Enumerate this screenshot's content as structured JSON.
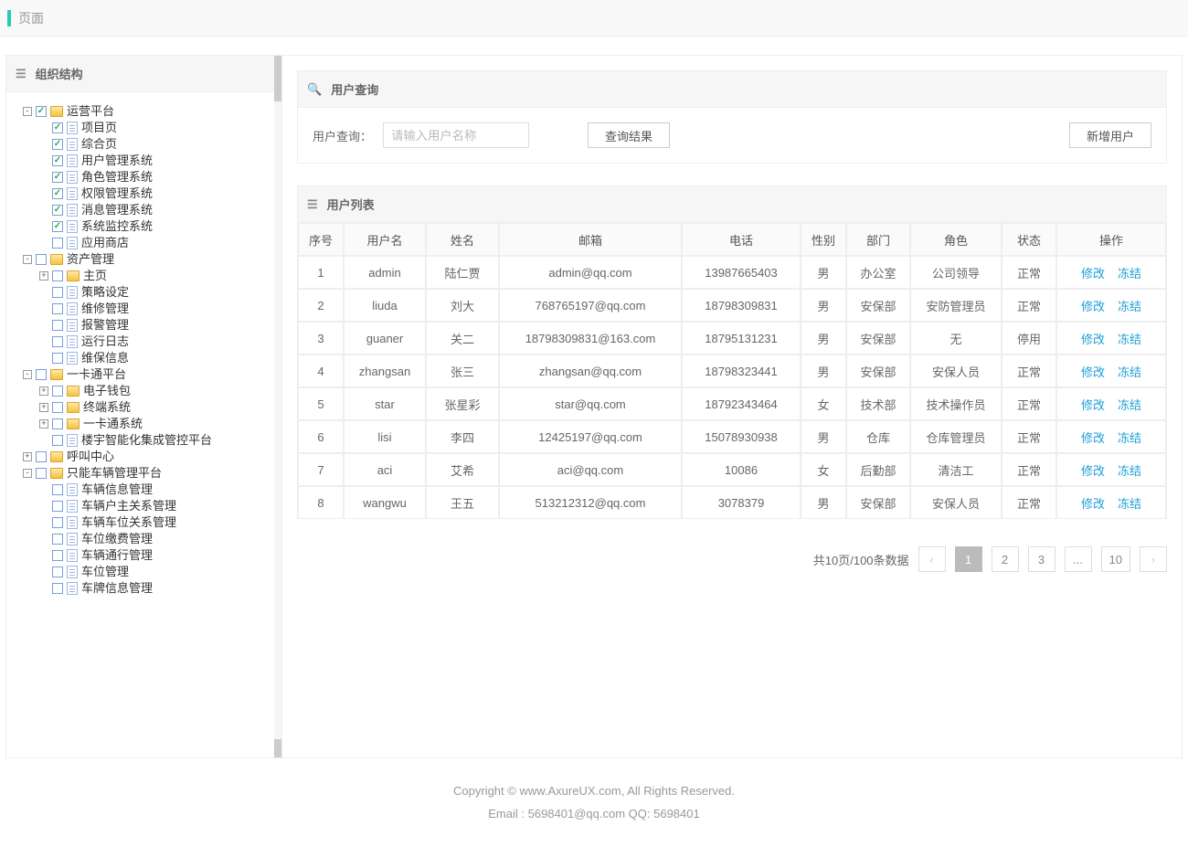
{
  "topbar": {
    "title": "页面"
  },
  "sidebar": {
    "title": "组织结构",
    "tree": [
      {
        "expand": "-",
        "checked": true,
        "icon": "folder",
        "label": "运营平台",
        "children": [
          {
            "expand": "",
            "checked": true,
            "icon": "page",
            "label": "项目页"
          },
          {
            "expand": "",
            "checked": true,
            "icon": "page",
            "label": "综合页"
          },
          {
            "expand": "",
            "checked": true,
            "icon": "page",
            "label": "用户管理系统"
          },
          {
            "expand": "",
            "checked": true,
            "icon": "page",
            "label": "角色管理系统"
          },
          {
            "expand": "",
            "checked": true,
            "icon": "page",
            "label": "权限管理系统"
          },
          {
            "expand": "",
            "checked": true,
            "icon": "page",
            "label": "消息管理系统"
          },
          {
            "expand": "",
            "checked": true,
            "icon": "page",
            "label": "系统监控系统"
          },
          {
            "expand": "",
            "checked": false,
            "icon": "page",
            "label": "应用商店"
          }
        ]
      },
      {
        "expand": "-",
        "checked": false,
        "icon": "folder",
        "label": "资产管理",
        "children": [
          {
            "expand": "+",
            "checked": false,
            "icon": "folder",
            "label": "主页"
          },
          {
            "expand": "",
            "checked": false,
            "icon": "page",
            "label": "策略设定"
          },
          {
            "expand": "",
            "checked": false,
            "icon": "page",
            "label": "维修管理"
          },
          {
            "expand": "",
            "checked": false,
            "icon": "page",
            "label": "报警管理"
          },
          {
            "expand": "",
            "checked": false,
            "icon": "page",
            "label": "运行日志"
          },
          {
            "expand": "",
            "checked": false,
            "icon": "page",
            "label": "维保信息"
          }
        ]
      },
      {
        "expand": "-",
        "checked": false,
        "icon": "folder",
        "label": "一卡通平台",
        "children": [
          {
            "expand": "+",
            "checked": false,
            "icon": "folder",
            "label": "电子钱包"
          },
          {
            "expand": "+",
            "checked": false,
            "icon": "folder",
            "label": "终端系统"
          },
          {
            "expand": "+",
            "checked": false,
            "icon": "folder",
            "label": "一卡通系统"
          },
          {
            "expand": "",
            "checked": false,
            "icon": "page",
            "label": "楼宇智能化集成管控平台"
          }
        ]
      },
      {
        "expand": "+",
        "checked": false,
        "icon": "folder",
        "label": "呼叫中心"
      },
      {
        "expand": "-",
        "checked": false,
        "icon": "folder",
        "label": "只能车辆管理平台",
        "children": [
          {
            "expand": "",
            "checked": false,
            "icon": "page",
            "label": "车辆信息管理"
          },
          {
            "expand": "",
            "checked": false,
            "icon": "page",
            "label": "车辆户主关系管理"
          },
          {
            "expand": "",
            "checked": false,
            "icon": "page",
            "label": "车辆车位关系管理"
          },
          {
            "expand": "",
            "checked": false,
            "icon": "page",
            "label": "车位缴费管理"
          },
          {
            "expand": "",
            "checked": false,
            "icon": "page",
            "label": "车辆通行管理"
          },
          {
            "expand": "",
            "checked": false,
            "icon": "page",
            "label": "车位管理"
          },
          {
            "expand": "",
            "checked": false,
            "icon": "page",
            "label": "车牌信息管理"
          }
        ]
      }
    ]
  },
  "search": {
    "panel_title": "用户查询",
    "label": "用户查询：",
    "placeholder": "请输入用户名称",
    "query_btn": "查询结果",
    "add_btn": "新增用户"
  },
  "table": {
    "panel_title": "用户列表",
    "headers": [
      "序号",
      "用户名",
      "姓名",
      "邮箱",
      "电话",
      "性别",
      "部门",
      "角色",
      "状态",
      "操作"
    ],
    "ops": {
      "edit": "修改",
      "freeze": "冻结"
    },
    "rows": [
      {
        "no": "1",
        "user": "admin",
        "name": "陆仁贾",
        "email": "admin@qq.com",
        "phone": "13987665403",
        "sex": "男",
        "dept": "办公室",
        "role": "公司领导",
        "status": "正常"
      },
      {
        "no": "2",
        "user": "liuda",
        "name": "刘大",
        "email": "768765197@qq.com",
        "phone": "18798309831",
        "sex": "男",
        "dept": "安保部",
        "role": "安防管理员",
        "status": "正常"
      },
      {
        "no": "3",
        "user": "guaner",
        "name": "关二",
        "email": "18798309831@163.com",
        "phone": "18795131231",
        "sex": "男",
        "dept": "安保部",
        "role": "无",
        "status": "停用"
      },
      {
        "no": "4",
        "user": "zhangsan",
        "name": "张三",
        "email": "zhangsan@qq.com",
        "phone": "18798323441",
        "sex": "男",
        "dept": "安保部",
        "role": "安保人员",
        "status": "正常"
      },
      {
        "no": "5",
        "user": "star",
        "name": "张星彩",
        "email": "star@qq.com",
        "phone": "18792343464",
        "sex": "女",
        "dept": "技术部",
        "role": "技术操作员",
        "status": "正常"
      },
      {
        "no": "6",
        "user": "lisi",
        "name": "李四",
        "email": "12425197@qq.com",
        "phone": "15078930938",
        "sex": "男",
        "dept": "仓库",
        "role": "仓库管理员",
        "status": "正常"
      },
      {
        "no": "7",
        "user": "aci",
        "name": "艾希",
        "email": "aci@qq.com",
        "phone": "10086",
        "sex": "女",
        "dept": "后勤部",
        "role": "清洁工",
        "status": "正常"
      },
      {
        "no": "8",
        "user": "wangwu",
        "name": "王五",
        "email": "513212312@qq.com",
        "phone": "3078379",
        "sex": "男",
        "dept": "安保部",
        "role": "安保人员",
        "status": "正常"
      }
    ]
  },
  "pager": {
    "summary": "共10页/100条数据",
    "pages": [
      "1",
      "2",
      "3",
      "...",
      "10"
    ],
    "active": "1"
  },
  "footer": {
    "line1": "Copyright © www.AxureUX.com, All Rights Reserved.",
    "line2": "Email : 5698401@qq.com  QQ: 5698401"
  }
}
